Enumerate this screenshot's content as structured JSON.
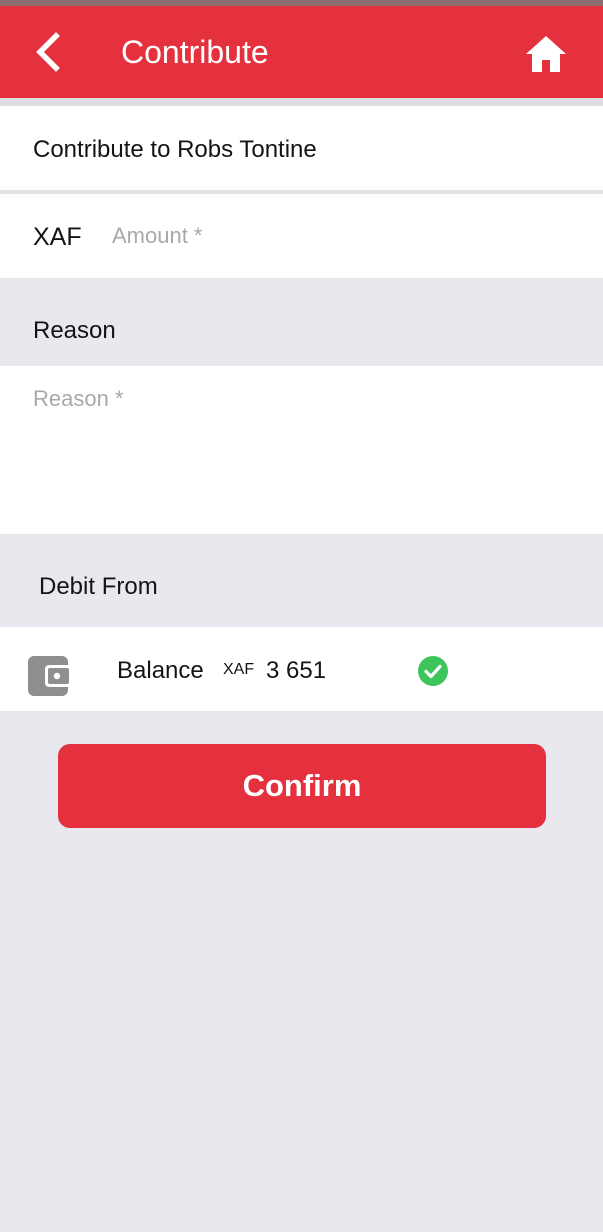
{
  "appbar": {
    "title": "Contribute",
    "back_icon": "chevron-left-icon",
    "home_icon": "home-icon",
    "color": "#e5313d"
  },
  "form": {
    "contribute_to": "Contribute to Robs Tontine",
    "amount": {
      "currency": "XAF",
      "value": "",
      "placeholder": "Amount *"
    },
    "reason": {
      "heading": "Reason",
      "value": "",
      "placeholder": "Reason *"
    },
    "debit": {
      "heading": "Debit From",
      "source": {
        "icon": "wallet-icon",
        "label": "Balance",
        "currency": "XAF",
        "amount": "3 651",
        "selected": true,
        "selected_icon": "check-circle-icon",
        "selected_color": "#3dc45a"
      }
    },
    "confirm_label": "Confirm"
  }
}
